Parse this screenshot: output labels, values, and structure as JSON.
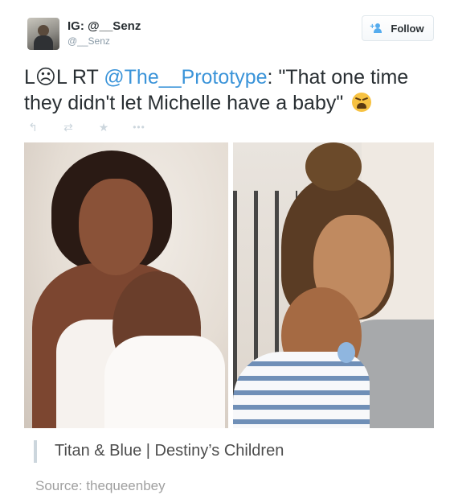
{
  "user": {
    "display_name": "IG: @__Senz",
    "screen_name": "@__Senz"
  },
  "follow_button": {
    "label": "Follow",
    "icon": "add-person-icon"
  },
  "tweet": {
    "text_prefix": "L☹L RT ",
    "mention": "@The__Prototype",
    "text_body": ": \"That one time they didn't let Michelle have a baby\" ",
    "emoji": "weary-face-emoji"
  },
  "actions": [
    {
      "name": "reply-icon",
      "glyph": "↰"
    },
    {
      "name": "retweet-icon",
      "glyph": "⇄"
    },
    {
      "name": "favorite-icon",
      "glyph": "★"
    },
    {
      "name": "more-icon",
      "glyph": "•••"
    }
  ],
  "caption": "Titan & Blue | Destiny’s Children",
  "source": "Source: thequeenbey",
  "colors": {
    "link": "#3b94d9",
    "action_icon": "#ccd6dd",
    "follow_icon": "#55acee"
  }
}
